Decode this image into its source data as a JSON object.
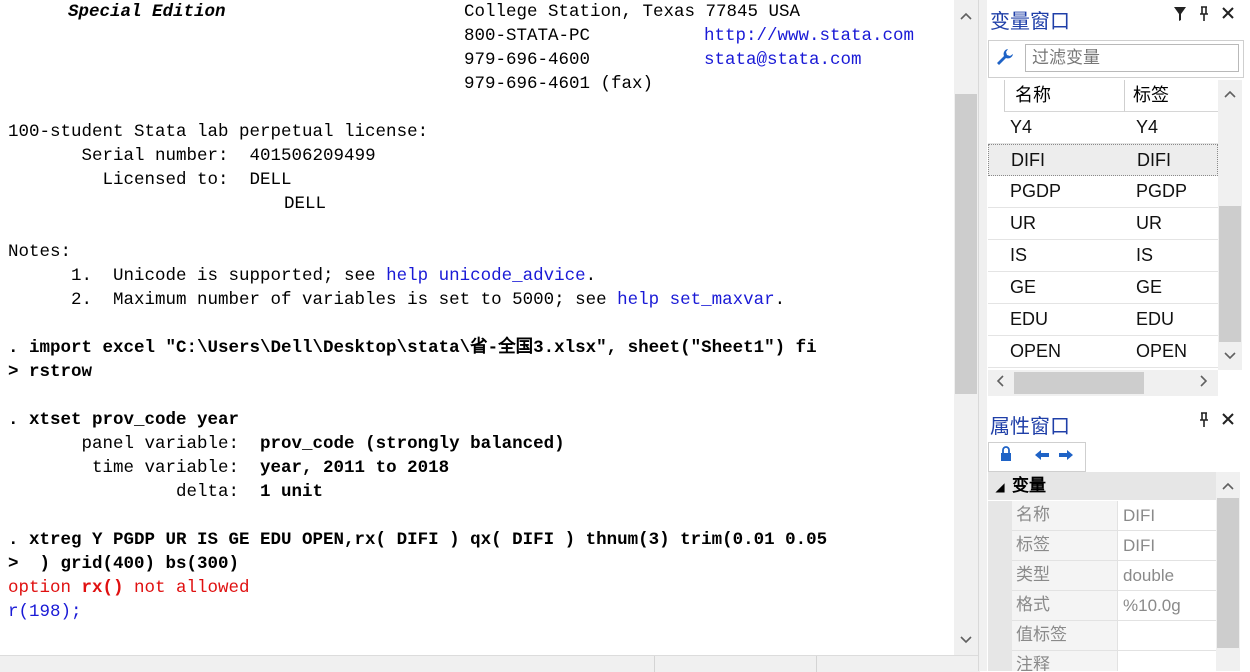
{
  "results": {
    "header": {
      "edition": "Special Edition",
      "address": "College Station, Texas 77845 USA",
      "phone": "800-STATA-PC",
      "website": "http://www.stata.com",
      "phone2": "979-696-4600",
      "email": "stata@stata.com",
      "fax": "979-696-4601 (fax)"
    },
    "license": {
      "line": "100-student Stata lab perpetual license:",
      "serial_label": "       Serial number:  ",
      "serial": "401506209499",
      "licensed_label": "         Licensed to:  ",
      "licensed_to_1": "DELL",
      "licensed_to_2": "DELL"
    },
    "notes": {
      "title": "Notes:",
      "n1_prefix": "      1.  Unicode is supported; see ",
      "n1_link": "help unicode_advice",
      "n1_suffix": ".",
      "n2_prefix": "      2.  Maximum number of variables is set to 5000; see ",
      "n2_link": "help set_maxvar",
      "n2_suffix": "."
    },
    "import_cmd_1": ". import excel \"C:\\Users\\Dell\\Desktop\\stata\\省-全国3.xlsx\", sheet(\"Sheet1\") fi",
    "import_cmd_2": "> rstrow",
    "xtset_cmd": ". xtset prov_code year",
    "panel_label": "       panel variable:  ",
    "panel_value": "prov_code (strongly balanced)",
    "time_label": "        time variable:  ",
    "time_value": "year, 2011 to 2018",
    "delta_label": "                delta:  ",
    "delta_value": "1 unit",
    "xtreg_cmd_1": ". xtreg Y PGDP UR IS GE EDU OPEN,rx( DIFI ) qx( DIFI ) thnum(3) trim(0.01 0.05",
    "xtreg_cmd_2": ">  ) grid(400) bs(300)",
    "error_prefix": "option ",
    "error_keyword": "rx()",
    "error_suffix": " not allowed",
    "return_code": "r(198);"
  },
  "variables_pane": {
    "title": "变量窗口",
    "filter_placeholder": "过滤变量",
    "col_name": "名称",
    "col_label": "标签",
    "rows": [
      {
        "name": "Y4",
        "label": "Y4"
      },
      {
        "name": "DIFI",
        "label": "DIFI"
      },
      {
        "name": "PGDP",
        "label": "PGDP"
      },
      {
        "name": "UR",
        "label": "UR"
      },
      {
        "name": "IS",
        "label": "IS"
      },
      {
        "name": "GE",
        "label": "GE"
      },
      {
        "name": "EDU",
        "label": "EDU"
      },
      {
        "name": "OPEN",
        "label": "OPEN"
      }
    ],
    "selected_row": "DIFI"
  },
  "properties_pane": {
    "title": "属性窗口",
    "category": "变量",
    "rows": [
      {
        "key": "名称",
        "value": "DIFI"
      },
      {
        "key": "标签",
        "value": "DIFI"
      },
      {
        "key": "类型",
        "value": "double"
      },
      {
        "key": "格式",
        "value": "%10.0g"
      },
      {
        "key": "值标签",
        "value": ""
      },
      {
        "key": "注释",
        "value": ""
      }
    ]
  },
  "icons": {
    "filter": "wrench-icon",
    "pin": "pin-icon",
    "close": "close-icon",
    "dropdown": "filter-funnel-icon",
    "lock": "lock-icon",
    "back": "arrow-left-icon",
    "forward": "arrow-right-icon"
  },
  "colors": {
    "link": "#1a1ad6",
    "error": "#e01010",
    "pane_title": "#1f3fa8"
  }
}
